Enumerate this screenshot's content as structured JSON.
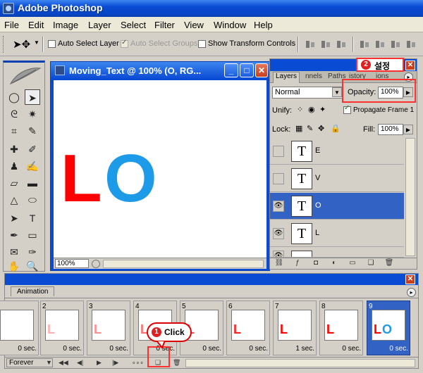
{
  "app": {
    "title": "Adobe Photoshop"
  },
  "menu": [
    "File",
    "Edit",
    "Image",
    "Layer",
    "Select",
    "Filter",
    "View",
    "Window",
    "Help"
  ],
  "options": {
    "auto_select_layer": {
      "label": "Auto Select Layer",
      "checked": false
    },
    "auto_select_groups": {
      "label": "Auto Select Groups",
      "checked": true,
      "enabled": false
    },
    "show_transform": {
      "label": "Show Transform Controls",
      "checked": false
    }
  },
  "document": {
    "title": "Moving_Text @ 100% (O, RG...",
    "text_L": "L",
    "text_O": "O",
    "zoom": "100%",
    "colors": {
      "L": "#ff0000",
      "O": "#1e9be8"
    }
  },
  "layers_panel": {
    "tabs": [
      "Layers",
      "Channels",
      "Paths",
      "History",
      "Actions"
    ],
    "tab_visible": [
      "Layers",
      "nnels",
      "Paths",
      "istory",
      "ions"
    ],
    "blend_mode": "Normal",
    "opacity_label": "Opacity:",
    "opacity": "100%",
    "unify_label": "Unify:",
    "propagate_label": "Propagate Frame 1",
    "lock_label": "Lock:",
    "fill_label": "Fill:",
    "fill": "100%",
    "layers": [
      {
        "name": "E",
        "thumb": "T",
        "visible": false,
        "selected": false
      },
      {
        "name": "V",
        "thumb": "T",
        "visible": false,
        "selected": false
      },
      {
        "name": "O",
        "thumb": "T",
        "visible": true,
        "selected": true
      },
      {
        "name": "L",
        "thumb": "T",
        "visible": true,
        "selected": false
      }
    ]
  },
  "animation": {
    "tab": "Animation",
    "loop": "Forever",
    "frames": [
      {
        "num": "",
        "time": "0 sec."
      },
      {
        "num": "2",
        "time": "0 sec."
      },
      {
        "num": "3",
        "time": "0 sec."
      },
      {
        "num": "4",
        "time": "0 sec."
      },
      {
        "num": "5",
        "time": "0 sec."
      },
      {
        "num": "6",
        "time": "0 sec."
      },
      {
        "num": "7",
        "time": "1 sec."
      },
      {
        "num": "8",
        "time": "0 sec."
      },
      {
        "num": "9",
        "time": "0 sec."
      }
    ]
  },
  "annotations": {
    "step1_num": "1",
    "step1_label": "Click",
    "step2_num": "2",
    "step2_label": "설정"
  }
}
